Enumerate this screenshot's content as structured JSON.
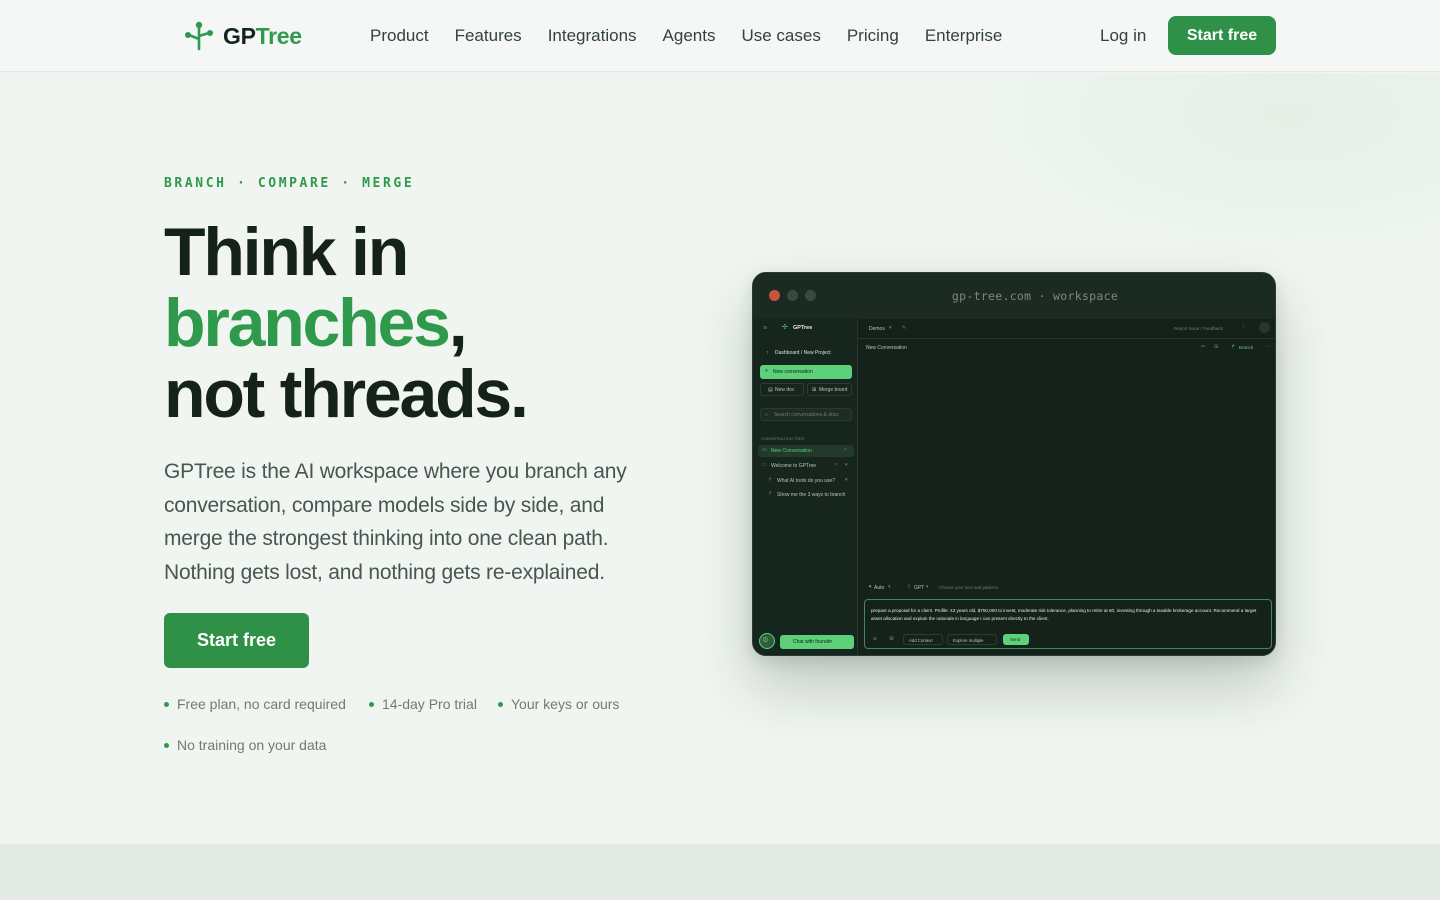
{
  "nav": {
    "logo_prefix": "GP",
    "logo_suffix": "Tree",
    "links": [
      "Product",
      "Features",
      "Integrations",
      "Agents",
      "Use cases",
      "Pricing",
      "Enterprise"
    ],
    "login": "Log in",
    "cta": "Start free"
  },
  "hero": {
    "eyebrow": "BRANCH · COMPARE · MERGE",
    "title_line1": "Think in",
    "title_line2_green": "branches",
    "title_line2_rest": ",",
    "title_line3": "not threads.",
    "lede": "GPTree is the AI workspace where you branch any conversation, compare models side by side, and merge the strongest thinking into one clean path. Nothing gets lost, and nothing gets re-explained.",
    "cta": "Start free",
    "perks": [
      "Free plan, no card required",
      "14-day Pro trial",
      "Your keys or ours",
      "No training on your data"
    ]
  },
  "window": {
    "title": "gp-tree.com · workspace",
    "app": {
      "brand": "GPTree",
      "breadcrumb": "Dashboard / New Project",
      "new_conversation": "New conversation",
      "new_doc": "New doc",
      "merge_board": "Merge board",
      "search_placeholder": "Search conversations & docs",
      "tree_heading": "CONVERSATION TREE",
      "tree_items": [
        "New Conversation",
        "Welcome to GPTree",
        "What AI tools do you use?",
        "Show me the 3 ways to branch"
      ],
      "chat_with_founder": "Chat with founder",
      "top_model": "Demos",
      "report_issue": "Report issue / Feedback",
      "conversation_title": "New Conversation",
      "branch_label": "Branch",
      "mode_auto": "Auto",
      "mode_gpt": "GPT",
      "composer_hint": "Choose your tone and patterns",
      "composer_text": "prepare a proposal for a client. Profile: 43 years old, $750,000 to invest, moderate risk tolerance, planning to retire at 60, investing through a taxable brokerage account. Recommend a target asset allocation and explain the rationale in language I can present directly to the client.",
      "add_context": "Add Context",
      "explore_multiple": "Explore multiple",
      "send": "Send"
    }
  },
  "colors": {
    "accent": "#2e9147",
    "accent_text": "#2f9a4b",
    "dark": "#14221a",
    "app_bg": "#13211a",
    "app_accent": "#5dd07a"
  }
}
